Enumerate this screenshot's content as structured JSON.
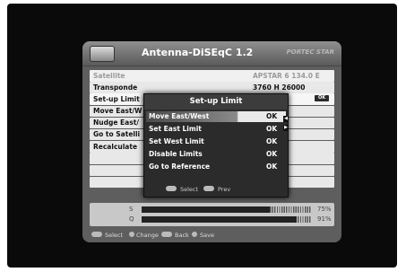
{
  "window": {
    "title": "Antenna-DiSEqC 1.2",
    "brand": "PORTEC STAR"
  },
  "menu": [
    {
      "label": "Satellite",
      "value": "APSTAR 6   134.0 E",
      "dim": true
    },
    {
      "label": "Transponde",
      "value": "3760 H 26000"
    },
    {
      "label": "Set-up Limit",
      "value": "",
      "ok": "OK"
    },
    {
      "label": "Move East/W",
      "value": ""
    },
    {
      "label": "Nudge East/",
      "value": ""
    },
    {
      "label": "Go to Satelli",
      "value": ""
    },
    {
      "label": "Recalculate",
      "value": ""
    }
  ],
  "signal": [
    {
      "label": "S",
      "percent": "75%",
      "level": 0.75
    },
    {
      "label": "Q",
      "percent": "91%",
      "level": 0.91
    }
  ],
  "footer": {
    "select": "Select",
    "change": "Change",
    "back": "Back",
    "save": "Save"
  },
  "popup": {
    "title": "Set-up Limit",
    "items": [
      {
        "label": "Move East/West",
        "value": "OK"
      },
      {
        "label": "Set East Limit",
        "value": "OK"
      },
      {
        "label": "Set West Limit",
        "value": "OK"
      },
      {
        "label": "Disable Limits",
        "value": "OK"
      },
      {
        "label": "Go to Reference",
        "value": "OK"
      }
    ],
    "footer": {
      "select": "Select",
      "prev": "Prev"
    }
  }
}
